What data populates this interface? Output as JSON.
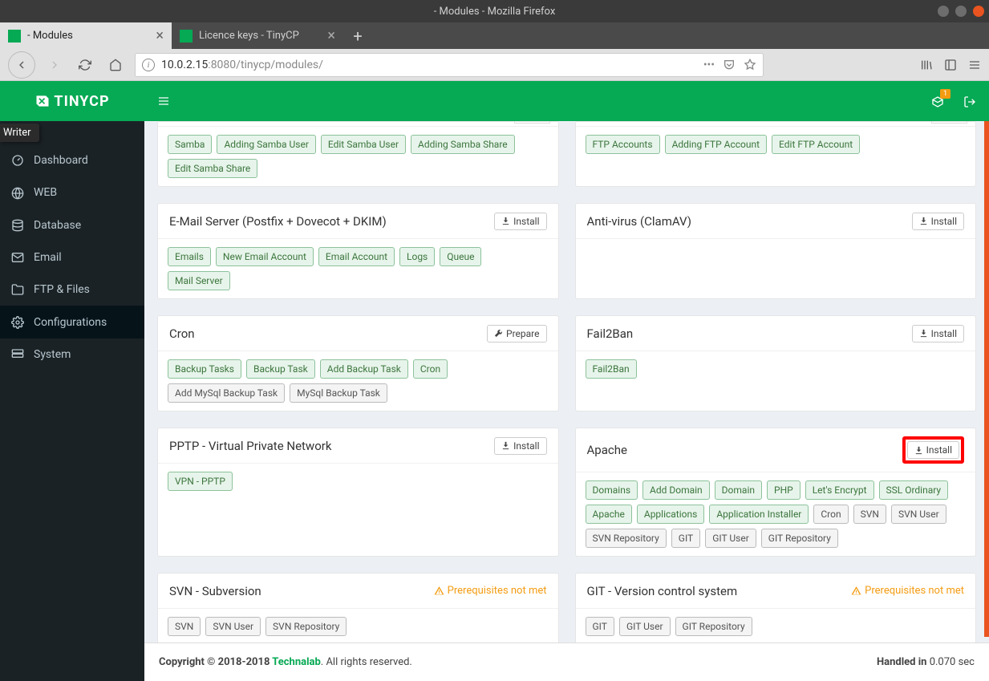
{
  "os": {
    "title": "- Modules - Mozilla Firefox"
  },
  "browser": {
    "tabs": [
      {
        "label": "- Modules"
      },
      {
        "label": "Licence keys - TinyCP"
      }
    ],
    "url": {
      "host_prefix": "10.0.2.15",
      "port": ":8080",
      "path": "/tinycp/modules/"
    }
  },
  "writer_badge": "Writer",
  "app": {
    "logo": "TINYCP",
    "menu_label": "MENU",
    "sidebar": {
      "items": [
        {
          "label": "Dashboard",
          "icon": "dashboard-icon"
        },
        {
          "label": "WEB",
          "icon": "globe-icon"
        },
        {
          "label": "Database",
          "icon": "database-icon"
        },
        {
          "label": "Email",
          "icon": "email-icon"
        },
        {
          "label": "FTP & Files",
          "icon": "folder-icon"
        },
        {
          "label": "Configurations",
          "icon": "gear-icon"
        },
        {
          "label": "System",
          "icon": "server-icon"
        }
      ]
    },
    "topbar": {
      "badge": "1"
    },
    "modules": {
      "left": [
        {
          "title": "",
          "header_visible": false,
          "tags": [
            {
              "t": "Samba",
              "g": true
            },
            {
              "t": "Adding Samba User",
              "g": true
            },
            {
              "t": "Edit Samba User",
              "g": true
            },
            {
              "t": "Adding Samba Share",
              "g": true
            },
            {
              "t": "Edit Samba Share",
              "g": true
            }
          ]
        },
        {
          "title": "E-Mail Server (Postfix + Dovecot + DKIM)",
          "action": "Install",
          "tags": [
            {
              "t": "Emails",
              "g": true
            },
            {
              "t": "New Email Account",
              "g": true
            },
            {
              "t": "Email Account",
              "g": true
            },
            {
              "t": "Logs",
              "g": true
            },
            {
              "t": "Queue",
              "g": true
            },
            {
              "t": "Mail Server",
              "g": true
            }
          ]
        },
        {
          "title": "Cron",
          "action": "Prepare",
          "action_icon": "wrench",
          "tags": [
            {
              "t": "Backup Tasks",
              "g": true
            },
            {
              "t": "Backup Task",
              "g": true
            },
            {
              "t": "Add Backup Task",
              "g": true
            },
            {
              "t": "Cron",
              "g": true
            },
            {
              "t": "Add MySql Backup Task",
              "g": false
            },
            {
              "t": "MySql Backup Task",
              "g": false
            }
          ]
        },
        {
          "title": "PPTP - Virtual Private Network",
          "action": "Install",
          "tags": [
            {
              "t": "VPN - PPTP",
              "g": true
            }
          ]
        },
        {
          "title": "SVN - Subversion",
          "warn": "Prerequisites not met",
          "tags": [
            {
              "t": "SVN",
              "g": false
            },
            {
              "t": "SVN User",
              "g": false
            },
            {
              "t": "SVN Repository",
              "g": false
            }
          ]
        }
      ],
      "right": [
        {
          "title": "",
          "header_visible": false,
          "tags": [
            {
              "t": "FTP Accounts",
              "g": true
            },
            {
              "t": "Adding FTP Account",
              "g": true
            },
            {
              "t": "Edit FTP Account",
              "g": true
            }
          ]
        },
        {
          "title": "Anti-virus (ClamAV)",
          "action": "Install",
          "tags": []
        },
        {
          "title": "Fail2Ban",
          "action": "Install",
          "tags": [
            {
              "t": "Fail2Ban",
              "g": true
            }
          ]
        },
        {
          "title": "Apache",
          "action": "Install",
          "highlight": true,
          "tags": [
            {
              "t": "Domains",
              "g": true
            },
            {
              "t": "Add Domain",
              "g": true
            },
            {
              "t": "Domain",
              "g": true
            },
            {
              "t": "PHP",
              "g": true
            },
            {
              "t": "Let's Encrypt",
              "g": true
            },
            {
              "t": "SSL Ordinary",
              "g": true
            },
            {
              "t": "Apache",
              "g": true
            },
            {
              "t": "Applications",
              "g": true
            },
            {
              "t": "Application Installer",
              "g": true
            },
            {
              "t": "Cron",
              "g": false
            },
            {
              "t": "SVN",
              "g": false
            },
            {
              "t": "SVN User",
              "g": false
            },
            {
              "t": "SVN Repository",
              "g": false
            },
            {
              "t": "GIT",
              "g": false
            },
            {
              "t": "GIT User",
              "g": false
            },
            {
              "t": "GIT Repository",
              "g": false
            }
          ]
        },
        {
          "title": "GIT - Version control system",
          "warn": "Prerequisites not met",
          "tags": [
            {
              "t": "GIT",
              "g": false
            },
            {
              "t": "GIT User",
              "g": false
            },
            {
              "t": "GIT Repository",
              "g": false
            }
          ]
        }
      ]
    },
    "footer": {
      "copyright": "Copyright © 2018-2018 ",
      "brand": "Technalab",
      "suffix": ". All rights reserved.",
      "handled_label": "Handled in ",
      "handled_time": "0.070 sec"
    }
  }
}
